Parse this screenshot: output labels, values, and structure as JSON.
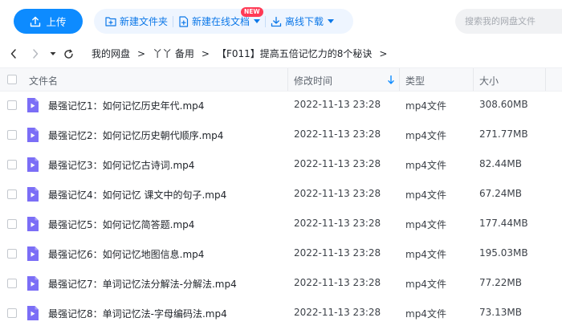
{
  "toolbar": {
    "upload_label": "上传",
    "new_folder_label": "新建文件夹",
    "new_online_doc_label": "新建在线文档",
    "new_badge": "NEW",
    "offline_download_label": "离线下载",
    "search_placeholder": "搜索我的网盘文件"
  },
  "breadcrumb": {
    "items": [
      "我的网盘",
      "丫丫 备用",
      "【F011】提高五倍记忆力的8个秘诀"
    ],
    "separator": ">"
  },
  "table": {
    "columns": [
      "文件名",
      "修改时间",
      "类型",
      "大小"
    ],
    "rows": [
      {
        "name": "最强记忆1：如何记忆历史年代.mp4",
        "modified": "2022-11-13 23:28",
        "type": "mp4文件",
        "size": "308.60MB"
      },
      {
        "name": "最强记忆2：如何记忆历史朝代顺序.mp4",
        "modified": "2022-11-13 23:28",
        "type": "mp4文件",
        "size": "271.77MB"
      },
      {
        "name": "最强记忆3：如何记忆古诗词.mp4",
        "modified": "2022-11-13 23:28",
        "type": "mp4文件",
        "size": "82.44MB"
      },
      {
        "name": "最强记忆4：如何记忆 课文中的句子.mp4",
        "modified": "2022-11-13 23:28",
        "type": "mp4文件",
        "size": "67.24MB"
      },
      {
        "name": "最强记忆5：如何记忆简答题.mp4",
        "modified": "2022-11-13 23:28",
        "type": "mp4文件",
        "size": "177.44MB"
      },
      {
        "name": "最强记忆6：如何记忆地图信息.mp4",
        "modified": "2022-11-13 23:28",
        "type": "mp4文件",
        "size": "195.03MB"
      },
      {
        "name": "最强记忆7：单词记忆法分解法-分解法.mp4",
        "modified": "2022-11-13 23:28",
        "type": "mp4文件",
        "size": "77.22MB"
      },
      {
        "name": "最强记忆8：单词记忆法-字母编码法.mp4",
        "modified": "2022-11-13 23:28",
        "type": "mp4文件",
        "size": "73.13MB"
      }
    ]
  },
  "colors": {
    "accent": "#0d8bff",
    "file_icon": "#7b6ef6"
  }
}
